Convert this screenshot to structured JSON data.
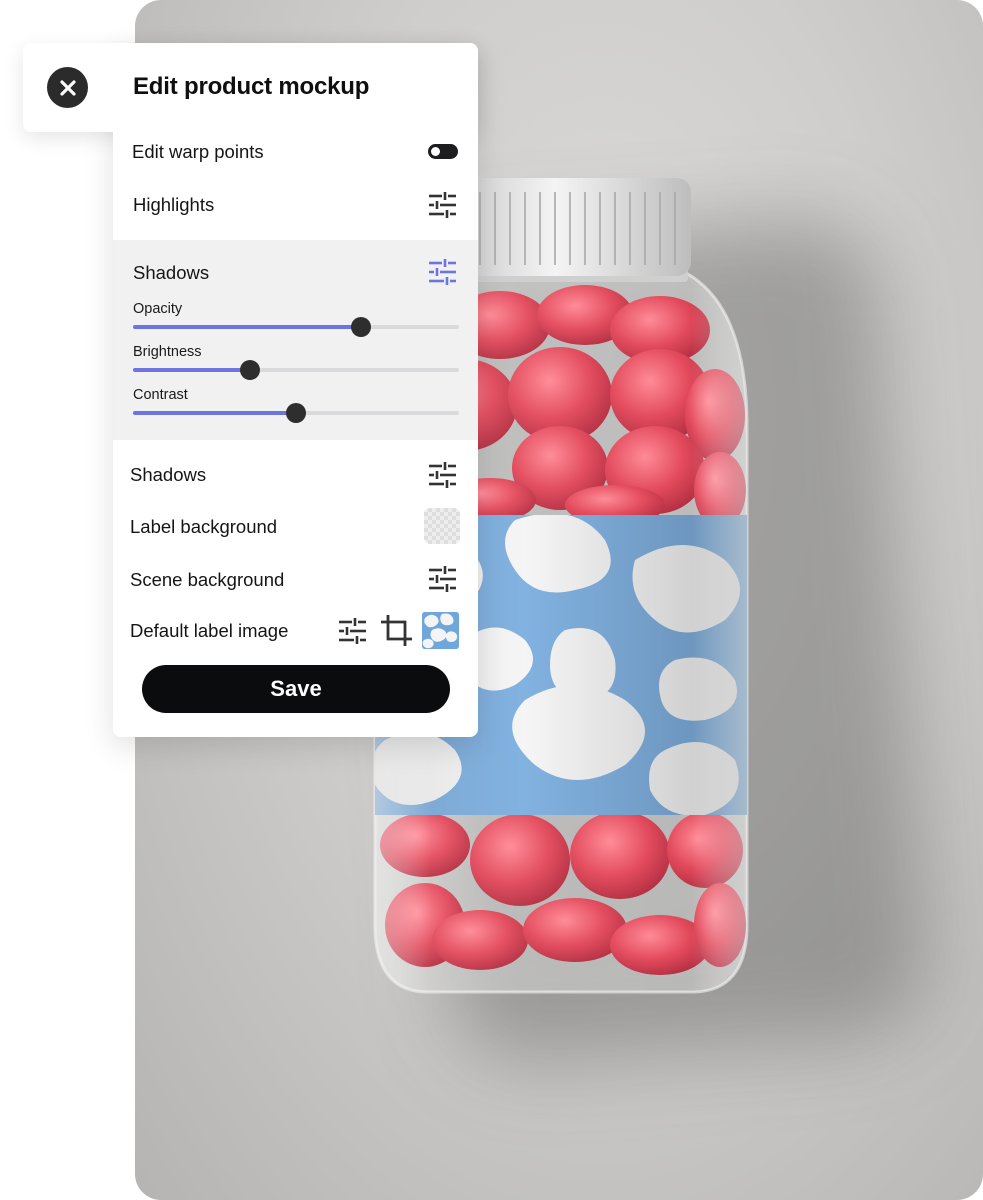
{
  "panel": {
    "title": "Edit product mockup",
    "close_icon": "close-icon"
  },
  "rows": {
    "edit_warp_points": {
      "label": "Edit warp points",
      "toggle_on": false
    },
    "highlights": {
      "label": "Highlights",
      "icon": "sliders-icon"
    },
    "shadows_expanded": {
      "label": "Shadows",
      "icon": "sliders-icon",
      "icon_color": "#6c74e2"
    },
    "shadows": {
      "label": "Shadows",
      "icon": "sliders-icon"
    },
    "label_background": {
      "label": "Label background",
      "icon": "transparent-swatch"
    },
    "scene_background": {
      "label": "Scene background",
      "icon": "sliders-icon"
    },
    "default_label_image": {
      "label": "Default label image",
      "icons": [
        "sliders-icon",
        "crop-icon",
        "label-thumbnail"
      ]
    }
  },
  "sliders": [
    {
      "label": "Opacity",
      "value": 0.7
    },
    {
      "label": "Brightness",
      "value": 0.36
    },
    {
      "label": "Contrast",
      "value": 0.5
    }
  ],
  "save": {
    "label": "Save"
  },
  "colors": {
    "accent": "#6c74e2",
    "button": "#0b0c0e",
    "label_blue": "#6fa6dc",
    "gummy_red": "#e0364a"
  }
}
